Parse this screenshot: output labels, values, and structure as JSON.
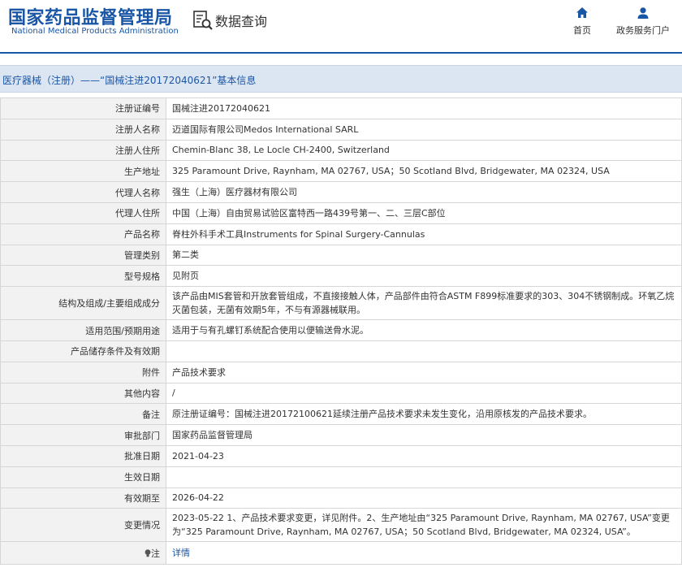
{
  "header": {
    "logo_cn": "国家药品监督管理局",
    "logo_en": "National Medical Products Administration",
    "data_query": "数据查询",
    "nav": {
      "home": "首页",
      "service": "政务服务门户"
    }
  },
  "page_title": "医疗器械（注册）——“国械注进20172040621”基本信息",
  "rows": [
    {
      "label": "注册证编号",
      "value": "国械注进20172040621"
    },
    {
      "label": "注册人名称",
      "value": "迈道国际有限公司Medos International SARL"
    },
    {
      "label": "注册人住所",
      "value": "Chemin-Blanc 38, Le Locle CH-2400, Switzerland"
    },
    {
      "label": "生产地址",
      "value": "325 Paramount Drive, Raynham, MA 02767, USA；50 Scotland Blvd, Bridgewater, MA 02324, USA"
    },
    {
      "label": "代理人名称",
      "value": "强生（上海）医疗器材有限公司"
    },
    {
      "label": "代理人住所",
      "value": "中国（上海）自由贸易试验区富特西一路439号第一、二、三层C部位"
    },
    {
      "label": "产品名称",
      "value": "脊柱外科手术工具Instruments for Spinal Surgery-Cannulas"
    },
    {
      "label": "管理类别",
      "value": "第二类"
    },
    {
      "label": "型号规格",
      "value": "见附页"
    },
    {
      "label": "结构及组成/主要组成成分",
      "value": "该产品由MIS套管和开放套管组成，不直接接触人体，产品部件由符合ASTM F899标准要求的303、304不锈钢制成。环氧乙烷灭菌包装，无菌有效期5年，不与有源器械联用。"
    },
    {
      "label": "适用范围/预期用途",
      "value": "适用于与有孔螺钉系统配合使用以便输送骨水泥。"
    },
    {
      "label": "产品储存条件及有效期",
      "value": ""
    },
    {
      "label": "附件",
      "value": "产品技术要求"
    },
    {
      "label": "其他内容",
      "value": "/"
    },
    {
      "label": "备注",
      "value": "原注册证编号：国械注进20172100621延续注册产品技术要求未发生变化，沿用原核发的产品技术要求。"
    },
    {
      "label": "审批部门",
      "value": "国家药品监督管理局"
    },
    {
      "label": "批准日期",
      "value": "2021-04-23"
    },
    {
      "label": "生效日期",
      "value": ""
    },
    {
      "label": "有效期至",
      "value": "2026-04-22"
    },
    {
      "label": "变更情况",
      "value": "2023-05-22 1、产品技术要求变更，详见附件。2、生产地址由“325 Paramount Drive, Raynham, MA 02767, USA”变更为“325 Paramount Drive, Raynham, MA 02767, USA；50 Scotland Blvd, Bridgewater, MA 02324, USA”。"
    }
  ],
  "hint": {
    "label": "注",
    "link": "详情"
  },
  "colors": {
    "brand_blue": "#1a56a6",
    "title_bar_bg": "#dce6f2",
    "label_bg": "#f2f2f2",
    "border": "#d6d6d6"
  }
}
